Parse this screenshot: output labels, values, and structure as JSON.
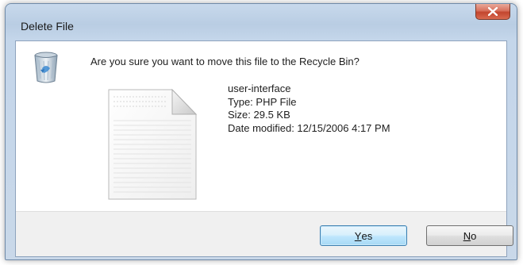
{
  "window": {
    "title": "Delete File"
  },
  "icons": {
    "close": "close-icon",
    "recycle_bin": "recycle-bin-icon",
    "file": "file-icon"
  },
  "message": "Are you sure you want to move this file to the Recycle Bin?",
  "file": {
    "name": "user-interface",
    "type": "Type: PHP File",
    "size": "Size: 29.5 KB",
    "modified": "Date modified: 12/15/2006 4:17 PM"
  },
  "buttons": {
    "yes": {
      "mnemonic": "Y",
      "rest": "es"
    },
    "no": {
      "mnemonic": "N",
      "rest": "o"
    }
  },
  "colors": {
    "frame": "#c4d6ea",
    "close_button": "#c2452e",
    "default_button_border": "#3c7fb1"
  }
}
